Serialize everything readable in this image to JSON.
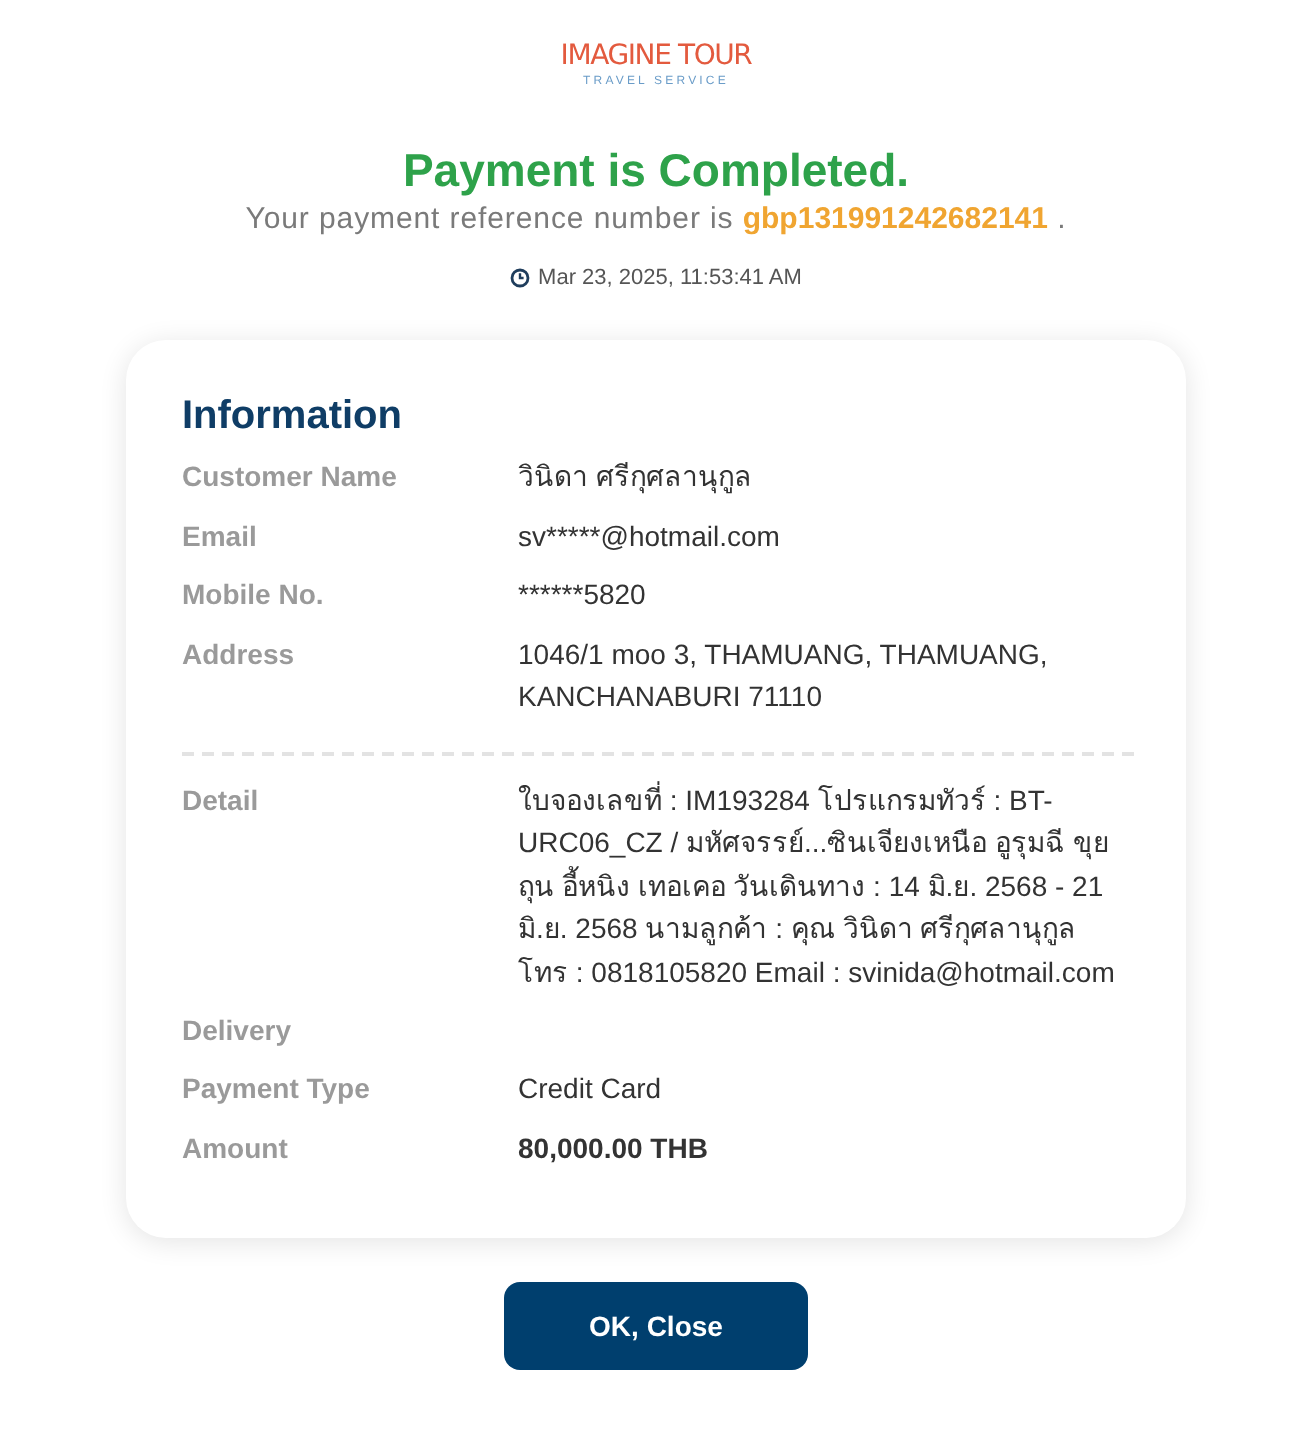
{
  "logo": {
    "name": "IMAGINE TOUR",
    "tagline": "TRAVEL SERVICE"
  },
  "status": {
    "title": "Payment is Completed.",
    "reference": "Your payment reference number is **gbp131991242682141** .",
    "timestamp": "Mar 23, 2025, 11:53:41 AM"
  },
  "information": {
    "title": "Information",
    "sections": [
      {
        "rows": [
          {
            "kind": "text",
            "label": "Customer Name",
            "value": "วินิดา ศรีกุศลานุกูล"
          },
          {
            "kind": "text",
            "label": "Email",
            "value": "sv*****@hotmail.com"
          },
          {
            "kind": "text",
            "label": "Mobile No.",
            "value": "******5820"
          },
          {
            "kind": "text",
            "label": "Address",
            "value": "1046/1 moo 3, THAMUANG, THAMUANG, KANCHANABURI 71110"
          }
        ]
      },
      {
        "rows": [
          {
            "kind": "text",
            "label": "Detail",
            "value": "ใบจองเลขที่ : IM193284 โปรแกรมทัวร์ : BT-URC06_CZ / มหัศจรรย์...ซินเจียงเหนือ อูรุมฉี ขุยถุน อี้หนิง เทอเคอ วันเดินทาง : 14 มิ.ย. 2568 - 21 มิ.ย. 2568 นามลูกค้า : คุณ วินิดา ศรีกุศลานุกูล โทร : 0818105820 Email : svinida@hotmail.com"
          },
          {
            "kind": "text",
            "label": "Delivery"
          },
          {
            "kind": "text",
            "label": "Payment Type",
            "value": "Credit Card"
          },
          {
            "kind": "amount",
            "label": "Amount",
            "value": "80,000.00 THB"
          }
        ]
      }
    ]
  },
  "buttons": [
    {
      "label": "OK, Close"
    }
  ]
}
